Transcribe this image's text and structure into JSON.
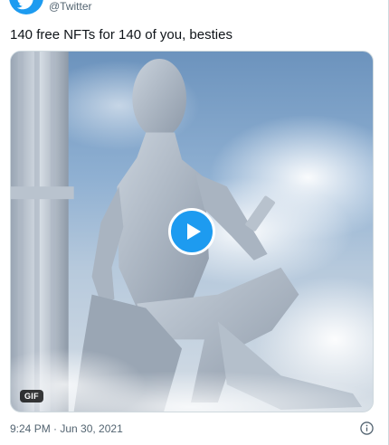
{
  "author": {
    "handle": "@Twitter",
    "avatar_icon": "twitter-bird-icon",
    "avatar_color": "#1d9bf0"
  },
  "tweet": {
    "text": "140 free NFTs for 140 of you, besties"
  },
  "media": {
    "type": "gif",
    "badge_label": "GIF",
    "play_icon": "play-icon",
    "accent": "#1d9bf0"
  },
  "meta": {
    "timestamp": "9:24 PM · Jun 30, 2021",
    "info_icon": "info-icon"
  }
}
